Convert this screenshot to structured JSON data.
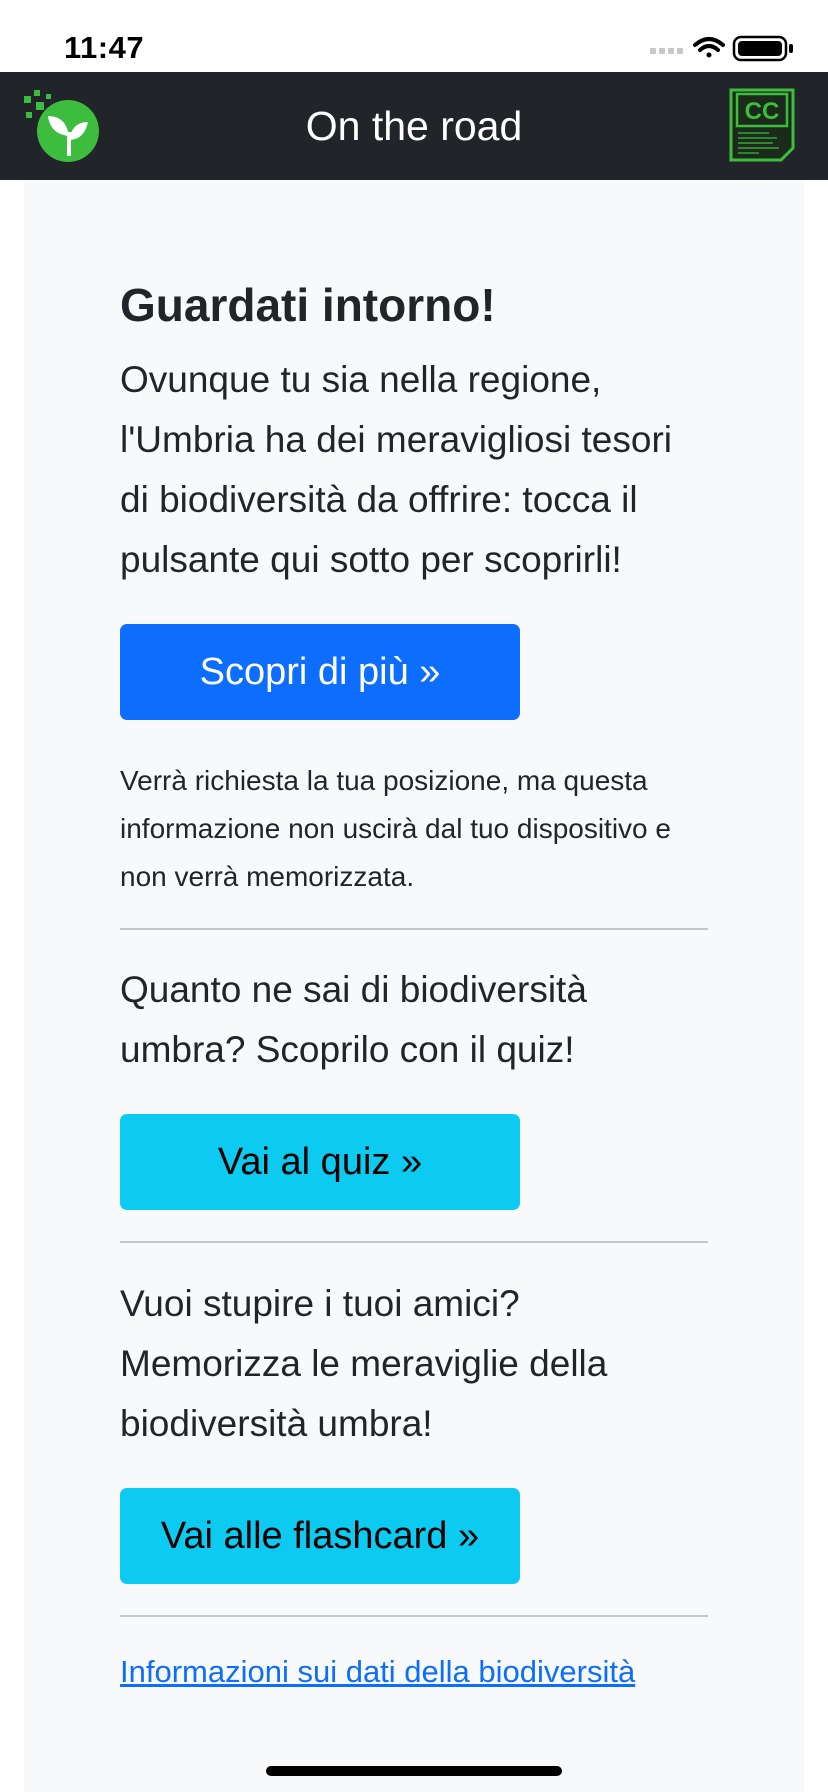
{
  "status_bar": {
    "time": "11:47",
    "icons": [
      "cellular-icon",
      "wifi-icon",
      "battery-icon"
    ]
  },
  "navbar": {
    "title": "On the road",
    "logo_icon": "leaf-logo-icon",
    "badge_icon": "cc-badge-icon",
    "background": "#212529",
    "logo_color": "#3dbd3d"
  },
  "main": {
    "heading": "Guardati intorno!",
    "intro": "Ovunque tu sia nella regione, l'Umbria ha dei meravigliosi tesori di biodiversità da offrire: tocca il pulsante qui sotto per scoprirli!",
    "discover_button": "Scopri di più »",
    "location_note": "Verrà richiesta la tua posizione, ma questa informazione non uscirà dal tuo dispositivo e non verrà memorizzata.",
    "quiz_text": "Quanto ne sai di biodiversità umbra? Scoprilo con il quiz!",
    "quiz_button": "Vai al quiz »",
    "flashcard_text": "Vuoi stupire i tuoi amici? Memorizza le meraviglie della biodiversità umbra!",
    "flashcard_button": "Vai alle flashcard »",
    "info_link": "Informazioni sui dati della biodiversità"
  },
  "colors": {
    "primary": "#0d6efd",
    "info": "#0dcaf0",
    "card_background": "#f8f9fa",
    "text": "#212529"
  }
}
